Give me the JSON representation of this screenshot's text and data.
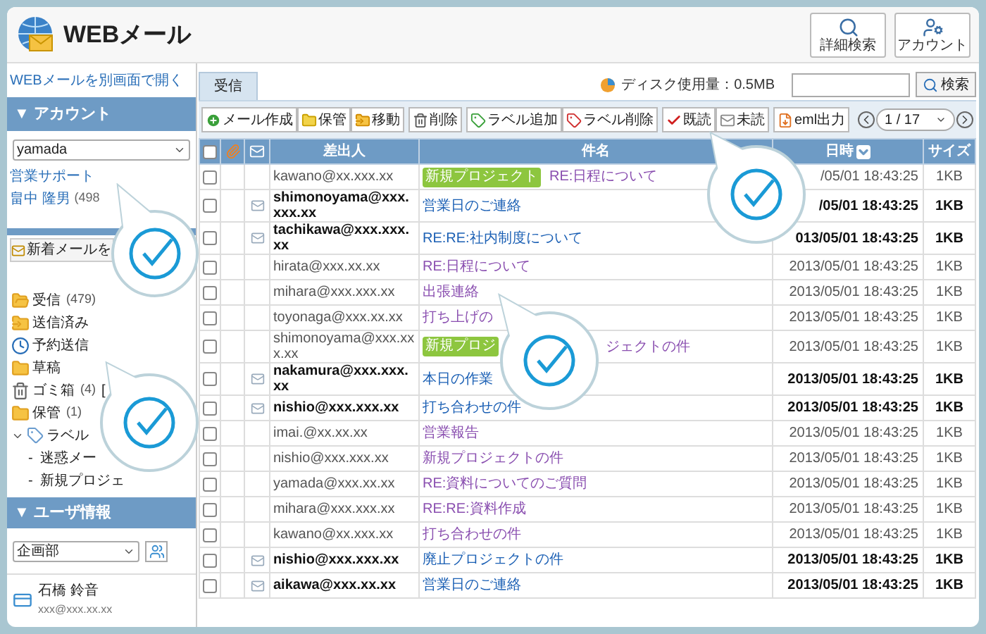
{
  "header": {
    "title": "WEBメール",
    "buttons": [
      {
        "kind": "search",
        "label": "詳細検索"
      },
      {
        "kind": "account",
        "label": "アカウント"
      }
    ]
  },
  "sidebar": {
    "open_link": "WEBメールを別画面で開く",
    "account_section": "▼ アカウント",
    "account_select": "yamada",
    "accounts": [
      {
        "name": "営業サポート"
      },
      {
        "name": "畠中 隆男",
        "count": "(498"
      }
    ],
    "new_mail_button": "新着メールを",
    "folders": [
      {
        "kind": "inbox",
        "label": "受信",
        "count": "(479)"
      },
      {
        "kind": "sent",
        "label": "送信済み"
      },
      {
        "kind": "scheduled",
        "label": "予約送信"
      },
      {
        "kind": "draft",
        "label": "草稿"
      },
      {
        "kind": "trash",
        "label": "ゴミ箱",
        "count": "(4)",
        "extra": "["
      },
      {
        "kind": "folder",
        "label": "保管",
        "count": "(1)"
      },
      {
        "kind": "label",
        "label": "ラベル",
        "expanded": true,
        "children": [
          {
            "bullet": "-",
            "label": "迷惑メー"
          },
          {
            "bullet": "-",
            "label": "新規プロジェ"
          }
        ]
      }
    ],
    "user_section": "▼ ユーザ情報",
    "group_select": "企画部",
    "user": {
      "name": "石橋 鈴音",
      "email": "xxx@xxx.xx.xx"
    }
  },
  "main": {
    "tabs": [
      {
        "label": "受信",
        "selected": true
      }
    ],
    "disk_usage": "ディスク使用量：0.5MB",
    "search_button": "検索",
    "toolbar": [
      [
        {
          "kind": "compose",
          "label": "メール作成"
        },
        {
          "kind": "archive",
          "label": "保管"
        },
        {
          "kind": "move",
          "label": "移動"
        }
      ],
      [
        {
          "kind": "delete",
          "label": "削除"
        }
      ],
      [
        {
          "kind": "label_add",
          "label": "ラベル追加"
        },
        {
          "kind": "label_remove",
          "label": "ラベル削除"
        }
      ],
      [
        {
          "kind": "read",
          "label": "既読"
        },
        {
          "kind": "unread",
          "label": "未読"
        }
      ],
      [
        {
          "kind": "export",
          "label": "eml出力"
        }
      ]
    ],
    "pager": "1 / 17",
    "select_all": {
      "checked": false
    },
    "columns": {
      "sender": "差出人",
      "subject": "件名",
      "date": "日時",
      "size": "サイズ"
    },
    "rows": [
      {
        "checked": false,
        "sender": "kawano@xx.xxx.xx",
        "tag": "新規プロジェクト",
        "subject": "RE:日程について",
        "date": "/05/01 18:43:25",
        "size": "1KB",
        "unread": false
      },
      {
        "checked": false,
        "sender": "shimonoyama@xxx.xxx.xx",
        "subject": "営業日のご連絡",
        "date": "/05/01 18:43:25",
        "size": "1KB",
        "unread": true
      },
      {
        "checked": false,
        "sender": "tachikawa@xxx.xxx.xx",
        "subject": "RE:RE:社内制度について",
        "date": "013/05/01 18:43:25",
        "size": "1KB",
        "unread": true
      },
      {
        "checked": false,
        "sender": "hirata@xxx.xx.xx",
        "subject": "RE:日程について",
        "date": "2013/05/01 18:43:25",
        "size": "1KB",
        "unread": false
      },
      {
        "checked": false,
        "sender": "mihara@xxx.xxx.xx",
        "subject": "出張連絡",
        "date": "2013/05/01 18:43:25",
        "size": "1KB",
        "unread": false
      },
      {
        "checked": false,
        "sender": "toyonaga@xxx.xx.xx",
        "subject": "打ち上げの",
        "date": "2013/05/01 18:43:25",
        "size": "1KB",
        "unread": false
      },
      {
        "checked": false,
        "sender": "shimonoyama@xxx.xxx.xx",
        "tag": "新規プロジ",
        "subject": "ジェクトの件",
        "subject_gap": true,
        "date": "2013/05/01 18:43:25",
        "size": "1KB",
        "unread": false
      },
      {
        "checked": false,
        "sender": "nakamura@xxx.xxx.xx",
        "subject": "本日の作業",
        "date": "2013/05/01 18:43:25",
        "size": "1KB",
        "unread": true
      },
      {
        "checked": false,
        "sender": "nishio@xxx.xxx.xx",
        "subject": "打ち合わせの件",
        "date": "2013/05/01 18:43:25",
        "size": "1KB",
        "unread": true
      },
      {
        "checked": false,
        "sender": "imai.@xx.xx.xx",
        "subject": "営業報告",
        "date": "2013/05/01 18:43:25",
        "size": "1KB",
        "unread": false
      },
      {
        "checked": false,
        "sender": "nishio@xxx.xxx.xx",
        "subject": "新規プロジェクトの件",
        "date": "2013/05/01 18:43:25",
        "size": "1KB",
        "unread": false
      },
      {
        "checked": false,
        "sender": "yamada@xxx.xx.xx",
        "subject": "RE:資料についてのご質問",
        "date": "2013/05/01 18:43:25",
        "size": "1KB",
        "unread": false
      },
      {
        "checked": false,
        "sender": "mihara@xxx.xxx.xx",
        "subject": "RE:RE:資料作成",
        "date": "2013/05/01 18:43:25",
        "size": "1KB",
        "unread": false
      },
      {
        "checked": false,
        "sender": "kawano@xx.xxx.xx",
        "subject": "打ち合わせの件",
        "date": "2013/05/01 18:43:25",
        "size": "1KB",
        "unread": false
      },
      {
        "checked": false,
        "sender": "nishio@xxx.xxx.xx",
        "subject": "廃止プロジェクトの件",
        "date": "2013/05/01 18:43:25",
        "size": "1KB",
        "unread": true
      },
      {
        "checked": false,
        "sender": "aikawa@xxx.xx.xx",
        "subject": "営業日のご連絡",
        "date": "2013/05/01 18:43:25",
        "size": "1KB",
        "unread": true
      }
    ]
  }
}
